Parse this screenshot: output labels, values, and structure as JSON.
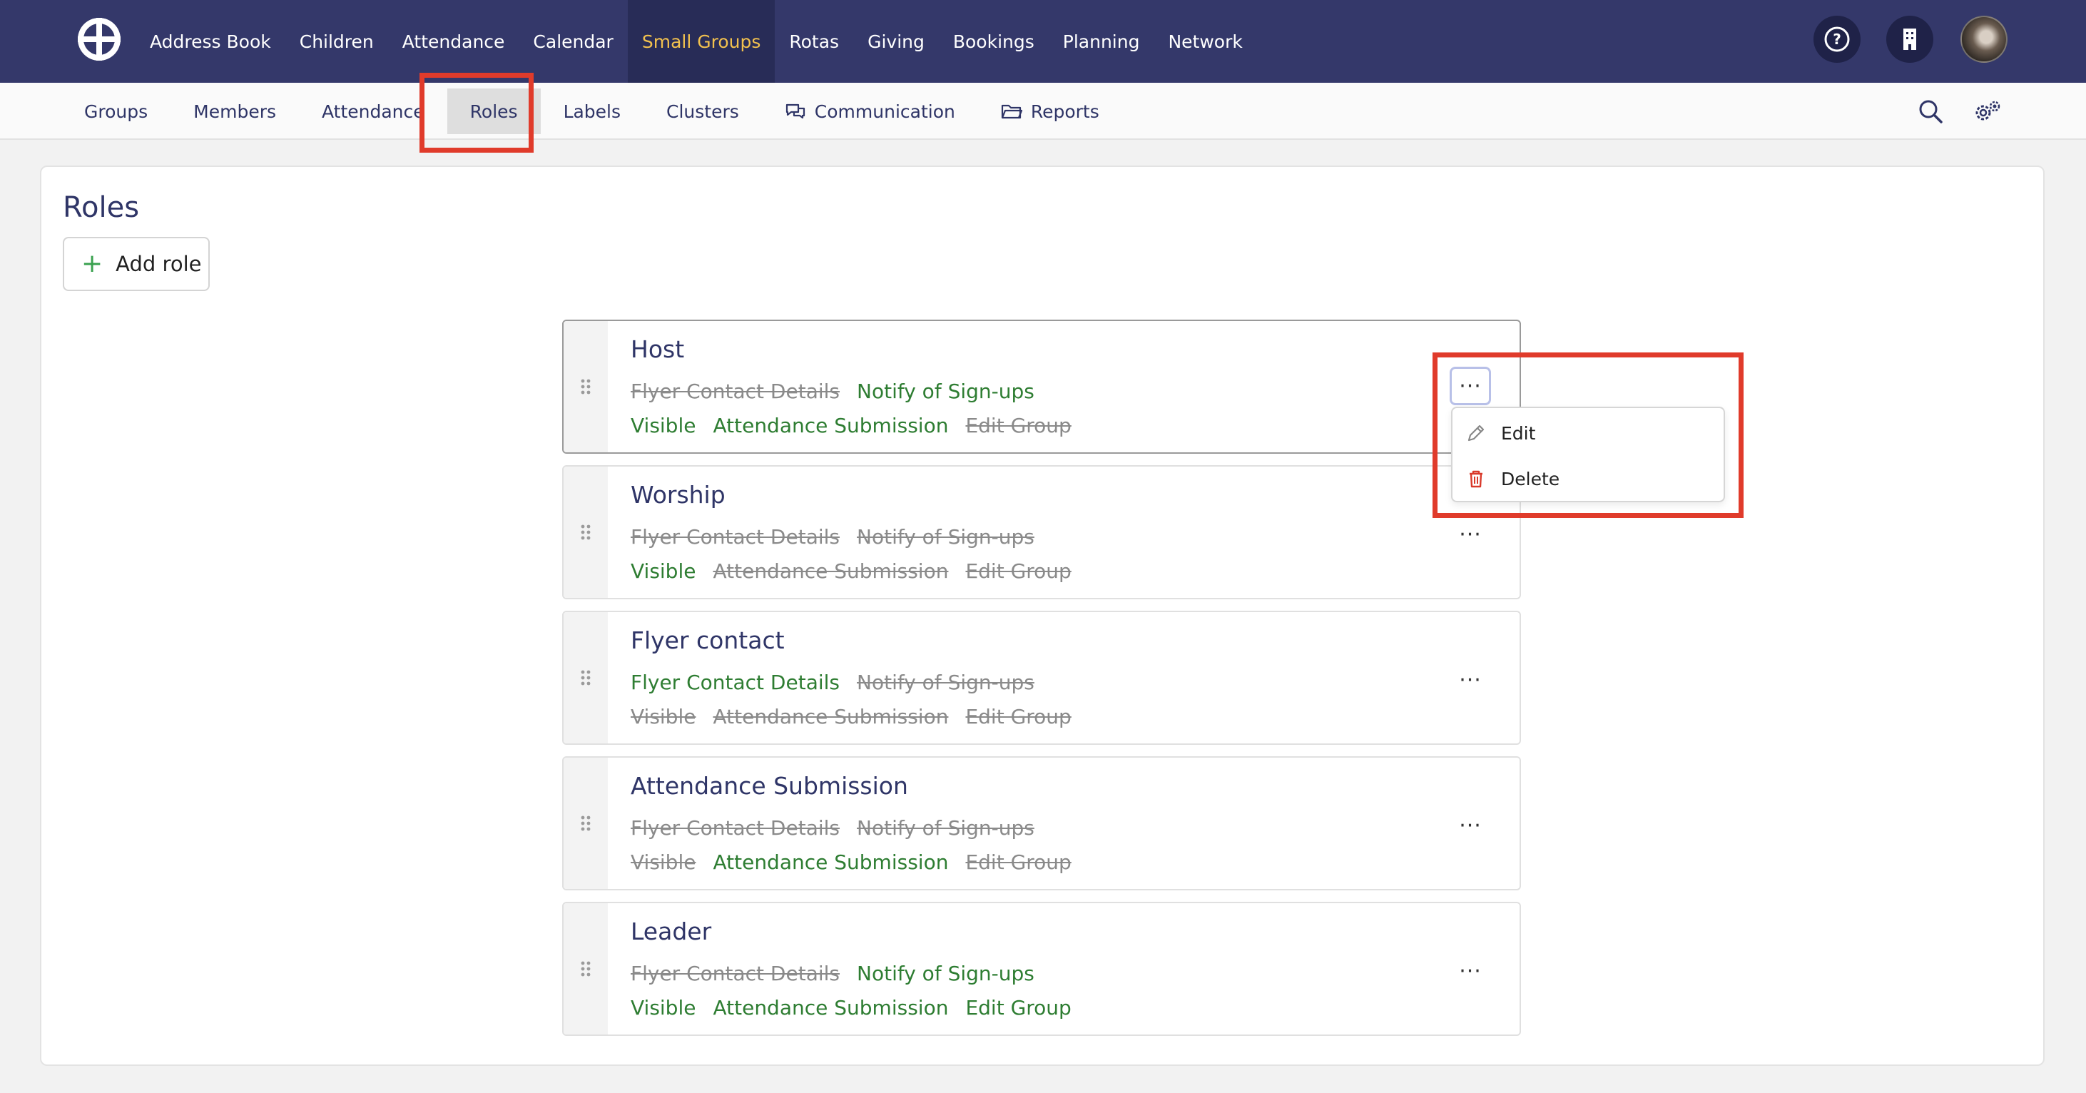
{
  "topnav": {
    "logo_icon": "globe-cross-logo",
    "items": [
      "Address Book",
      "Children",
      "Attendance",
      "Calendar",
      "Small Groups",
      "Rotas",
      "Giving",
      "Bookings",
      "Planning",
      "Network"
    ],
    "active": "Small Groups",
    "active_color": "#f2c14e",
    "right_icons": [
      "help-icon",
      "building-icon",
      "user-avatar"
    ]
  },
  "subnav": {
    "items": [
      "Groups",
      "Members",
      "Attendance",
      "Roles",
      "Labels",
      "Clusters",
      "Communication",
      "Reports"
    ],
    "active": "Roles",
    "right_icons": [
      "search-icon",
      "settings-icon"
    ]
  },
  "page": {
    "title": "Roles",
    "add_button": "Add role"
  },
  "permission_labels": {
    "flyer": "Flyer Contact Details",
    "notify": "Notify of Sign-ups",
    "visible": "Visible",
    "attendance": "Attendance Submission",
    "edit": "Edit Group"
  },
  "roles": [
    {
      "name": "Host",
      "flyer": false,
      "notify": true,
      "visible": true,
      "attendance": true,
      "edit": false
    },
    {
      "name": "Worship",
      "flyer": false,
      "notify": false,
      "visible": true,
      "attendance": false,
      "edit": false
    },
    {
      "name": "Flyer contact",
      "flyer": true,
      "notify": false,
      "visible": false,
      "attendance": false,
      "edit": false
    },
    {
      "name": "Attendance Submission",
      "flyer": false,
      "notify": false,
      "visible": false,
      "attendance": true,
      "edit": false
    },
    {
      "name": "Leader",
      "flyer": false,
      "notify": true,
      "visible": true,
      "attendance": true,
      "edit": true
    }
  ],
  "more_label": "···",
  "dropdown": {
    "items": [
      {
        "label": "Edit",
        "icon": "pencil-icon"
      },
      {
        "label": "Delete",
        "icon": "trash-icon"
      }
    ]
  },
  "colors": {
    "navbar": "#34386a",
    "permission_on": "#2e7d32",
    "permission_off": "#8a8a8a",
    "highlight": "#e03b2b"
  }
}
